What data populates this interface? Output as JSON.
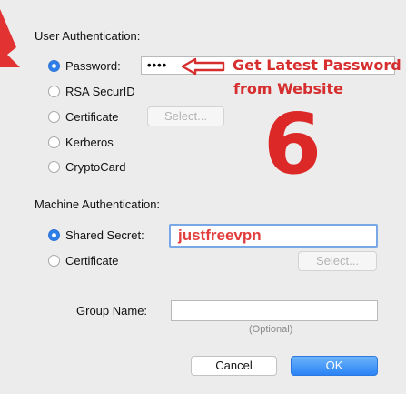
{
  "user_auth": {
    "title": "User Authentication:",
    "options": [
      {
        "label": "Password:",
        "selected": true
      },
      {
        "label": "RSA SecurID",
        "selected": false
      },
      {
        "label": "Certificate",
        "selected": false
      },
      {
        "label": "Kerberos",
        "selected": false
      },
      {
        "label": "CryptoCard",
        "selected": false
      }
    ],
    "password_value": "••••",
    "select_label": "Select..."
  },
  "annotation": {
    "line1": "Get Latest Password",
    "line2": "from Website",
    "step_number": "6",
    "color": "#d62e2e",
    "arrow_icon": "left-arrow-icon"
  },
  "machine_auth": {
    "title": "Machine Authentication:",
    "options": [
      {
        "label": "Shared Secret:",
        "selected": true
      },
      {
        "label": "Certificate",
        "selected": false
      }
    ],
    "shared_secret_value": "justfreevpn",
    "select_label": "Select..."
  },
  "group": {
    "label": "Group Name:",
    "value": "",
    "hint": "(Optional)"
  },
  "buttons": {
    "cancel": "Cancel",
    "ok": "OK"
  },
  "colors": {
    "accent": "#2f7fe8",
    "annotation_red": "#d62e2e",
    "background": "#ececec"
  }
}
